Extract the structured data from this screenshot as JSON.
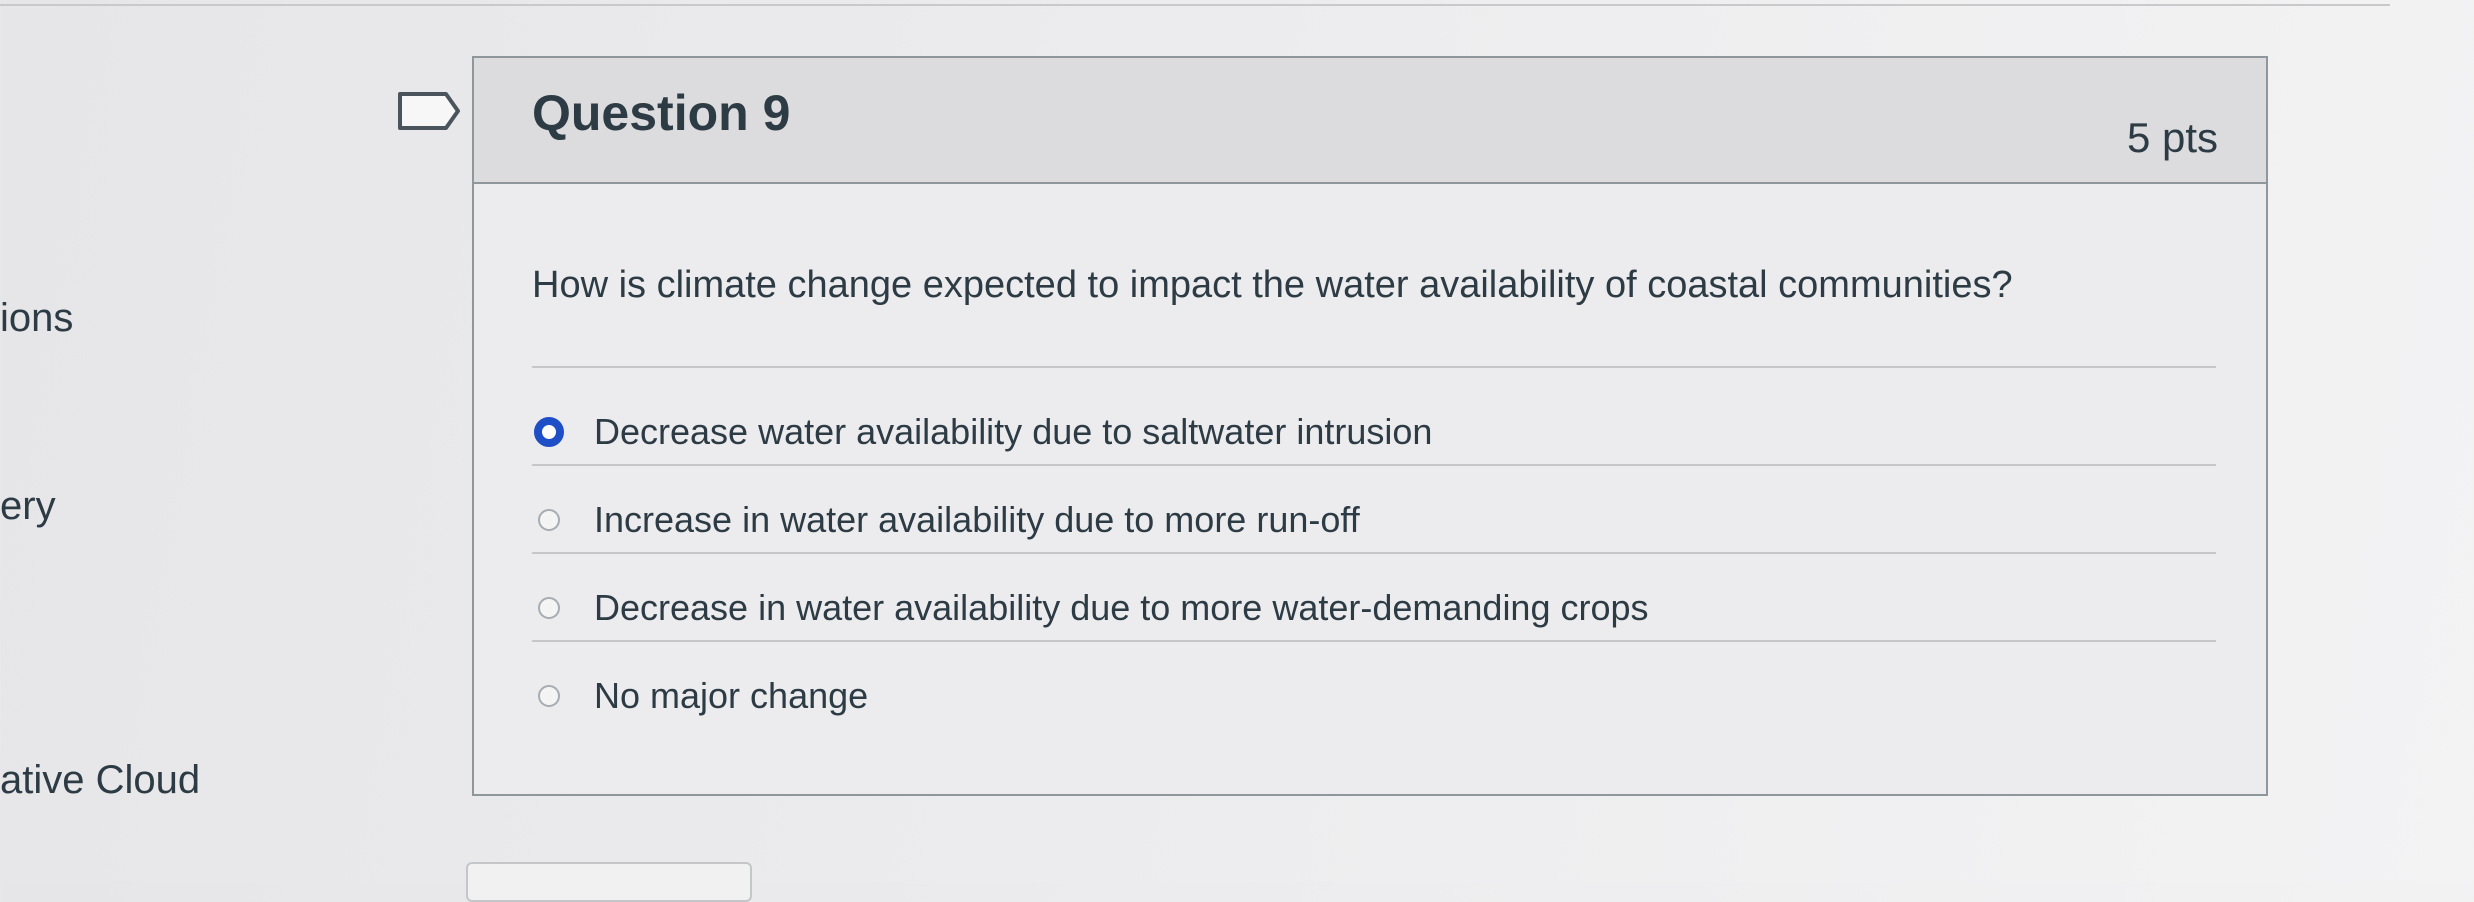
{
  "sidebar": {
    "items": [
      {
        "label": "ions"
      },
      {
        "label": "ery"
      },
      {
        "label": "ative Cloud"
      }
    ]
  },
  "question": {
    "title": "Question 9",
    "points": "5 pts",
    "text": "How is climate change expected to impact the water availability of coastal communities?",
    "answers": [
      {
        "label": "Decrease water availability due to saltwater intrusion",
        "selected": true
      },
      {
        "label": "Increase in water availability due to more run-off",
        "selected": false
      },
      {
        "label": "Decrease in water availability due to more water-demanding crops",
        "selected": false
      },
      {
        "label": "No major change",
        "selected": false
      }
    ]
  },
  "colors": {
    "accent": "#1f4fc7",
    "header_bg": "#dcdcde",
    "text": "#2d3b45",
    "border": "#8f969c"
  },
  "icons": {
    "flag": "flag-question-icon"
  }
}
